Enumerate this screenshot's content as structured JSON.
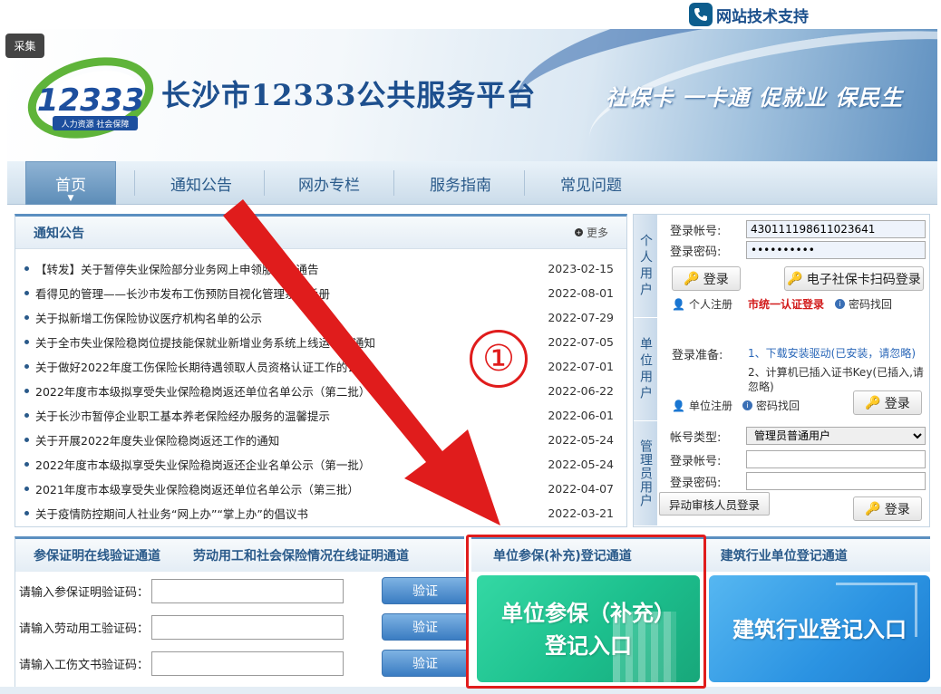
{
  "topbar": {
    "support_label": "网站技术支持",
    "collect_label": "采集"
  },
  "banner": {
    "title": "长沙市12333公共服务平台",
    "slogan": "社保卡 一卡通 促就业 保民生",
    "logo_number": "12333",
    "logo_sub": "人力资源 社会保障"
  },
  "nav": {
    "items": [
      "首页",
      "通知公告",
      "网办专栏",
      "服务指南",
      "常见问题"
    ],
    "active_index": 0
  },
  "notice": {
    "title": "通知公告",
    "more": "更多",
    "items": [
      {
        "title": "【转发】关于暂停失业保险部分业务网上申领服务的通告",
        "date": "2023-02-15"
      },
      {
        "title": "看得见的管理——长沙市发布工伤预防目视化管理系列手册",
        "date": "2022-08-01"
      },
      {
        "title": "关于拟新增工伤保险协议医疗机构名单的公示",
        "date": "2022-07-29"
      },
      {
        "title": "关于全市失业保险稳岗位提技能保就业新增业务系统上线运行的通知",
        "date": "2022-07-05"
      },
      {
        "title": "关于做好2022年度工伤保险长期待遇领取人员资格认证工作的公告",
        "date": "2022-07-01"
      },
      {
        "title": "2022年度市本级拟享受失业保险稳岗返还单位名单公示（第二批）",
        "date": "2022-06-22"
      },
      {
        "title": "关于长沙市暂停企业职工基本养老保险经办服务的温馨提示",
        "date": "2022-06-01"
      },
      {
        "title": "关于开展2022年度失业保险稳岗返还工作的通知",
        "date": "2022-05-24"
      },
      {
        "title": "2022年度市本级拟享受失业保险稳岗返还企业名单公示（第一批）",
        "date": "2022-05-24"
      },
      {
        "title": "2021年度市本级享受失业保险稳岗返还单位名单公示（第三批）",
        "date": "2022-04-07"
      },
      {
        "title": "关于疫情防控期间人社业务“网上办”“掌上办”的倡议书",
        "date": "2022-03-21"
      }
    ]
  },
  "login": {
    "personal": {
      "tab": "个人用户",
      "account_label": "登录帐号:",
      "account_value": "430111198611023641",
      "password_label": "登录密码:",
      "password_value": "••••••••••",
      "login_button": "登录",
      "ecard_button": "电子社保卡扫码登录",
      "register": "个人注册",
      "unified_login": "市统一认证登录",
      "recover": "密码找回"
    },
    "unit": {
      "tab": "单位用户",
      "prepare_label": "登录准备:",
      "step1": "1、下载安装驱动(已安装，请忽略)",
      "step2": "2、计算机已插入证书Key(已插入,请忽略)",
      "register": "单位注册",
      "recover": "密码找回",
      "login_button": "登录"
    },
    "admin": {
      "tab": "管理员用户",
      "type_label": "帐号类型:",
      "type_value": "管理员普通用户",
      "account_label": "登录帐号:",
      "password_label": "登录密码:",
      "audit_button": "异动审核人员登录",
      "login_button": "登录"
    }
  },
  "verify": {
    "tab1": "参保证明在线验证通道",
    "tab2": "劳动用工和社会保险情况在线证明通道",
    "rows": [
      {
        "label": "请输入参保证明验证码：",
        "button": "验证"
      },
      {
        "label": "请输入劳动用工验证码：",
        "button": "验证"
      },
      {
        "label": "请输入工伤文书验证码：",
        "button": "验证"
      }
    ]
  },
  "registration": {
    "unit_tab": "单位参保(补充)登记通道",
    "build_tab": "建筑行业单位登记通道",
    "unit_tile_line1": "单位参保（补充）",
    "unit_tile_line2": "登记入口",
    "build_tile": "建筑行业登记入口"
  },
  "annotation": {
    "step_number": "①",
    "color": "#e01c1c"
  }
}
